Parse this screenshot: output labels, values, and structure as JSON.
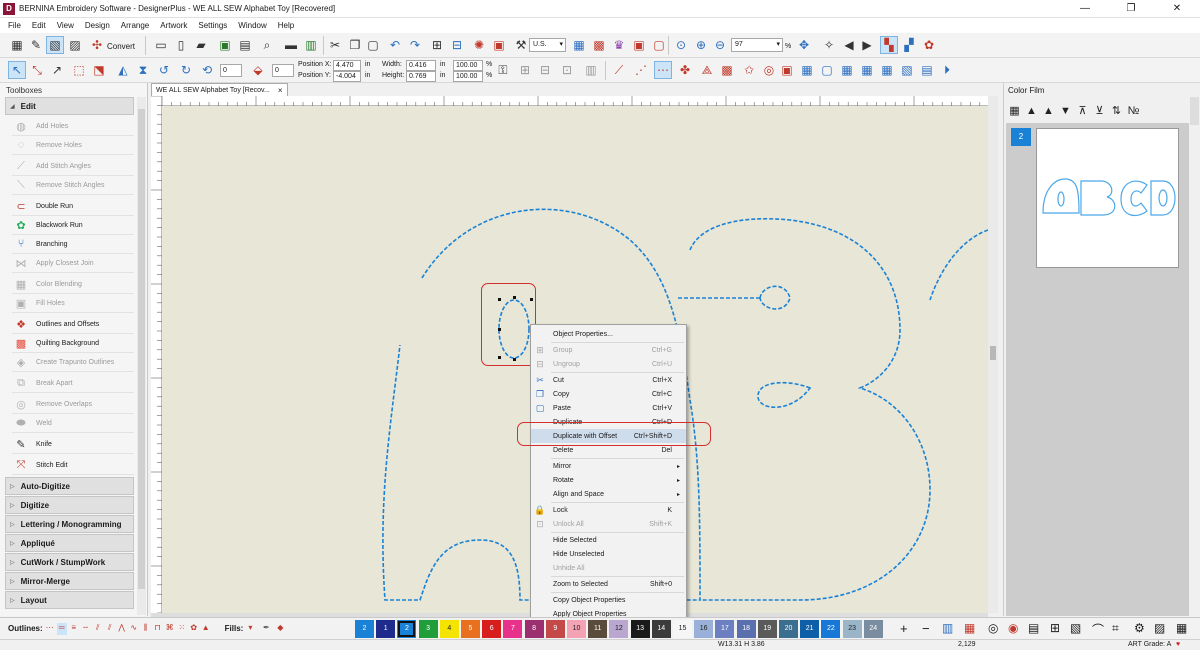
{
  "window": {
    "title": "BERNINA Embroidery Software - DesignerPlus - WE ALL SEW Alphabet Toy [Recovered]",
    "icon_letter": "D"
  },
  "menu": [
    "File",
    "Edit",
    "View",
    "Design",
    "Arrange",
    "Artwork",
    "Settings",
    "Window",
    "Help"
  ],
  "toolbar1": {
    "convert_label": "Convert",
    "units_value": "U.S.",
    "zoom_value": "97",
    "zoom_unit": "%"
  },
  "toolbar2": {
    "rotate_value": "0",
    "slant_value": "0",
    "position_x_label": "Position X:",
    "position_x_value": "4.470",
    "position_y_label": "Position Y:",
    "position_y_value": "-4.004",
    "width_label": "Width:",
    "width_value": "0.416",
    "height_label": "Height:",
    "height_value": "0.769",
    "unit_in": "in",
    "scale_w": "100.00",
    "scale_h": "100.00",
    "pct": "%"
  },
  "toolboxes": {
    "header": "Toolboxes",
    "edit_section": "Edit",
    "edit_items": [
      {
        "label": "Add Holes",
        "icon": "add-holes-icon",
        "glyph": "◍",
        "enabled": false,
        "color": "#b0b0b0"
      },
      {
        "label": "Remove Holes",
        "icon": "remove-holes-icon",
        "glyph": "◌",
        "enabled": false,
        "color": "#b0b0b0"
      },
      {
        "label": "Add Stitch Angles",
        "icon": "add-stitch-angles-icon",
        "glyph": "⟋",
        "enabled": false,
        "color": "#b0b0b0",
        "gap": true
      },
      {
        "label": "Remove Stitch Angles",
        "icon": "remove-stitch-angles-icon",
        "glyph": "⟍",
        "enabled": false,
        "color": "#b0b0b0"
      },
      {
        "label": "Double Run",
        "icon": "double-run-icon",
        "glyph": "⊂",
        "enabled": true,
        "color": "#c0392b",
        "gap": true
      },
      {
        "label": "Blackwork Run",
        "icon": "blackwork-run-icon",
        "glyph": "✿",
        "enabled": true,
        "color": "#27ae60"
      },
      {
        "label": "Branching",
        "icon": "branching-icon",
        "glyph": "⑂",
        "enabled": true,
        "color": "#2c6fbf"
      },
      {
        "label": "Apply Closest Join",
        "icon": "closest-join-icon",
        "glyph": "⋈",
        "enabled": false,
        "color": "#b0b0b0"
      },
      {
        "label": "Color Blending",
        "icon": "color-blending-icon",
        "glyph": "▦",
        "enabled": false,
        "color": "#b0b0b0",
        "gap": true
      },
      {
        "label": "Fill Holes",
        "icon": "fill-holes-icon",
        "glyph": "▣",
        "enabled": false,
        "color": "#b0b0b0"
      },
      {
        "label": "Outlines and Offsets",
        "icon": "outlines-offsets-icon",
        "glyph": "❖",
        "enabled": true,
        "color": "#c0392b",
        "gap": true
      },
      {
        "label": "Quilting Background",
        "icon": "quilting-background-icon",
        "glyph": "▩",
        "enabled": true,
        "color": "#e74c3c"
      },
      {
        "label": "Create Trapunto Outlines",
        "icon": "trapunto-outlines-icon",
        "glyph": "◈",
        "enabled": false,
        "color": "#b0b0b0"
      },
      {
        "label": "Break Apart",
        "icon": "break-apart-icon",
        "glyph": "⧉",
        "enabled": false,
        "color": "#b0b0b0",
        "gap": true
      },
      {
        "label": "Remove Overlaps",
        "icon": "remove-overlaps-icon",
        "glyph": "◎",
        "enabled": false,
        "color": "#b0b0b0",
        "gap": true
      },
      {
        "label": "Weld",
        "icon": "weld-icon",
        "glyph": "⬬",
        "enabled": false,
        "color": "#b0b0b0"
      },
      {
        "label": "Knife",
        "icon": "knife-icon",
        "glyph": "✎",
        "enabled": true,
        "color": "#333333",
        "gap": true
      },
      {
        "label": "Stitch Edit",
        "icon": "stitch-edit-icon",
        "glyph": "⤧",
        "enabled": true,
        "color": "#c0392b",
        "gap": true
      }
    ],
    "other_sections": [
      "Auto-Digitize",
      "Digitize",
      "Lettering / Monogramming",
      "Appliqué",
      "CutWork / StumpWork",
      "Mirror-Merge",
      "Layout"
    ]
  },
  "document_tab": {
    "label": "WE ALL SEW Alphabet Toy [Recov...",
    "close": "×"
  },
  "color_film": {
    "header": "Color Film",
    "item_number": "2"
  },
  "context_menu": [
    {
      "label": "Object Properties...",
      "shortcut": "",
      "enabled": true,
      "icon": ""
    },
    {
      "sep": true
    },
    {
      "label": "Group",
      "shortcut": "Ctrl+G",
      "enabled": false,
      "icon": "group-icon"
    },
    {
      "label": "Ungroup",
      "shortcut": "Ctrl+U",
      "enabled": false,
      "icon": "ungroup-icon"
    },
    {
      "sep": true
    },
    {
      "label": "Cut",
      "shortcut": "Ctrl+X",
      "enabled": true,
      "icon": "cut-icon"
    },
    {
      "label": "Copy",
      "shortcut": "Ctrl+C",
      "enabled": true,
      "icon": "copy-icon"
    },
    {
      "label": "Paste",
      "shortcut": "Ctrl+V",
      "enabled": true,
      "icon": "paste-icon"
    },
    {
      "label": "Duplicate",
      "shortcut": "Ctrl+D",
      "enabled": true,
      "icon": ""
    },
    {
      "label": "Duplicate with Offset",
      "shortcut": "Ctrl+Shift+D",
      "enabled": true,
      "icon": "",
      "highlighted": true
    },
    {
      "label": "Delete",
      "shortcut": "Del",
      "enabled": true,
      "icon": ""
    },
    {
      "sep": true
    },
    {
      "label": "Mirror",
      "shortcut": "",
      "enabled": true,
      "icon": "",
      "submenu": true
    },
    {
      "label": "Rotate",
      "shortcut": "",
      "enabled": true,
      "icon": "",
      "submenu": true
    },
    {
      "label": "Align and Space",
      "shortcut": "",
      "enabled": true,
      "icon": "",
      "submenu": true
    },
    {
      "sep": true
    },
    {
      "label": "Lock",
      "shortcut": "K",
      "enabled": true,
      "icon": "lock-icon"
    },
    {
      "label": "Unlock All",
      "shortcut": "Shift+K",
      "enabled": false,
      "icon": "unlock-icon"
    },
    {
      "sep": true
    },
    {
      "label": "Hide Selected",
      "shortcut": "",
      "enabled": true,
      "icon": ""
    },
    {
      "label": "Hide Unselected",
      "shortcut": "",
      "enabled": true,
      "icon": ""
    },
    {
      "label": "Unhide All",
      "shortcut": "",
      "enabled": false,
      "icon": ""
    },
    {
      "sep": true
    },
    {
      "label": "Zoom to Selected",
      "shortcut": "Shift+0",
      "enabled": true,
      "icon": ""
    },
    {
      "sep": true
    },
    {
      "label": "Copy Object Properties",
      "shortcut": "",
      "enabled": true,
      "icon": ""
    },
    {
      "label": "Apply Object Properties",
      "shortcut": "",
      "enabled": true,
      "icon": ""
    }
  ],
  "bottom": {
    "outlines_label": "Outlines:",
    "fills_label": "Fills:",
    "swatches": [
      {
        "n": "2",
        "color": "#1a82d6"
      },
      {
        "n": "1",
        "color": "#1e2a8c"
      },
      {
        "n": "2",
        "color": "#1a82d6",
        "selected": true
      },
      {
        "n": "3",
        "color": "#1f9e3a"
      },
      {
        "n": "4",
        "color": "#f5e400"
      },
      {
        "n": "5",
        "color": "#e8701e"
      },
      {
        "n": "6",
        "color": "#d81d1d"
      },
      {
        "n": "7",
        "color": "#e8318a"
      },
      {
        "n": "8",
        "color": "#9c2f70"
      },
      {
        "n": "9",
        "color": "#c44a4a"
      },
      {
        "n": "10",
        "color": "#f4a3b4"
      },
      {
        "n": "11",
        "color": "#5a4c3c"
      },
      {
        "n": "12",
        "color": "#b9a7d0"
      },
      {
        "n": "13",
        "color": "#1a1a1a"
      },
      {
        "n": "14",
        "color": "#3c3c3c"
      },
      {
        "n": "15",
        "color": "#f6f6f6"
      },
      {
        "n": "16",
        "color": "#9ab0d8"
      },
      {
        "n": "17",
        "color": "#6b7fc1"
      },
      {
        "n": "18",
        "color": "#5a6fae"
      },
      {
        "n": "19",
        "color": "#5a5a5a"
      },
      {
        "n": "20",
        "color": "#3b6e8f"
      },
      {
        "n": "21",
        "color": "#0f5fa8"
      },
      {
        "n": "22",
        "color": "#1778d8"
      },
      {
        "n": "23",
        "color": "#9ab4c8"
      },
      {
        "n": "24",
        "color": "#7a8ca0"
      }
    ]
  },
  "status": {
    "dimensions": "W13.31 H 3.86",
    "stitches": "2,129",
    "art_grade": "ART Grade: A"
  },
  "colors": {
    "accent": "#1a82d6",
    "stitch": "#1a82d6",
    "annotation": "#d32f2f",
    "canvas": "#e8e6d6"
  }
}
